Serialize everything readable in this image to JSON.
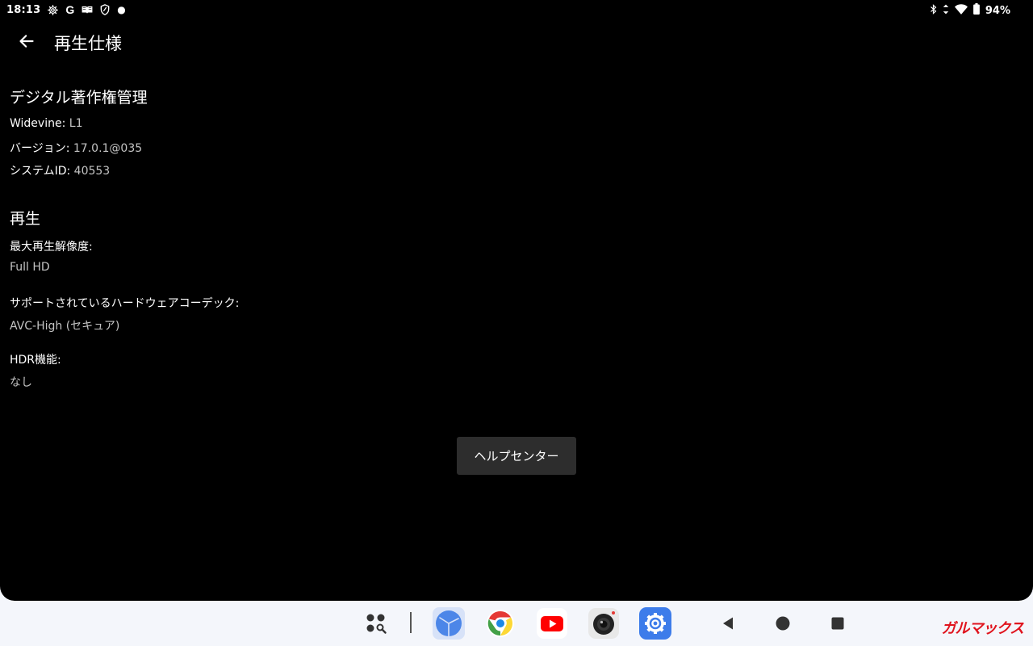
{
  "status_bar": {
    "time": "18:13",
    "google_letter": "G",
    "battery": "94%",
    "icons_left": [
      "settings-gear-icon",
      "google-icon",
      "book-icon",
      "shield-icon",
      "dot-icon"
    ],
    "icons_right": [
      "bluetooth-icon",
      "data-arrows-icon",
      "wifi-icon",
      "battery-icon"
    ]
  },
  "app_bar": {
    "title": "再生仕様"
  },
  "drm": {
    "heading": "デジタル著作権管理",
    "widevine_label": "Widevine:",
    "widevine_value": "L1",
    "version_label": "バージョン:",
    "version_value": "17.0.1@035",
    "system_id_label": "システムID:",
    "system_id_value": "40553"
  },
  "playback": {
    "heading": "再生",
    "max_resolution_label": "最大再生解像度:",
    "max_resolution_value": "Full HD",
    "hw_codec_label": "サポートされているハードウェアコーデック:",
    "hw_codec_value": "AVC-High (セキュア)",
    "hdr_label": "HDR機能:",
    "hdr_value": "なし"
  },
  "help_center_button": "ヘルプセンター",
  "taskbar": {
    "apps": [
      "app-drawer-icon",
      "clock-app-icon",
      "chrome-icon",
      "youtube-icon",
      "camera-icon",
      "settings-app-icon"
    ],
    "nav": [
      "nav-back-icon",
      "nav-home-icon",
      "nav-recents-icon"
    ]
  },
  "watermark": "ガルマックス",
  "colors": {
    "background": "#000000",
    "text_primary": "#ffffff",
    "text_secondary": "#c4c4c4",
    "button_bg": "#2d2d2d",
    "taskbar_bg": "#f4f6fb",
    "watermark": "#e0141e"
  }
}
